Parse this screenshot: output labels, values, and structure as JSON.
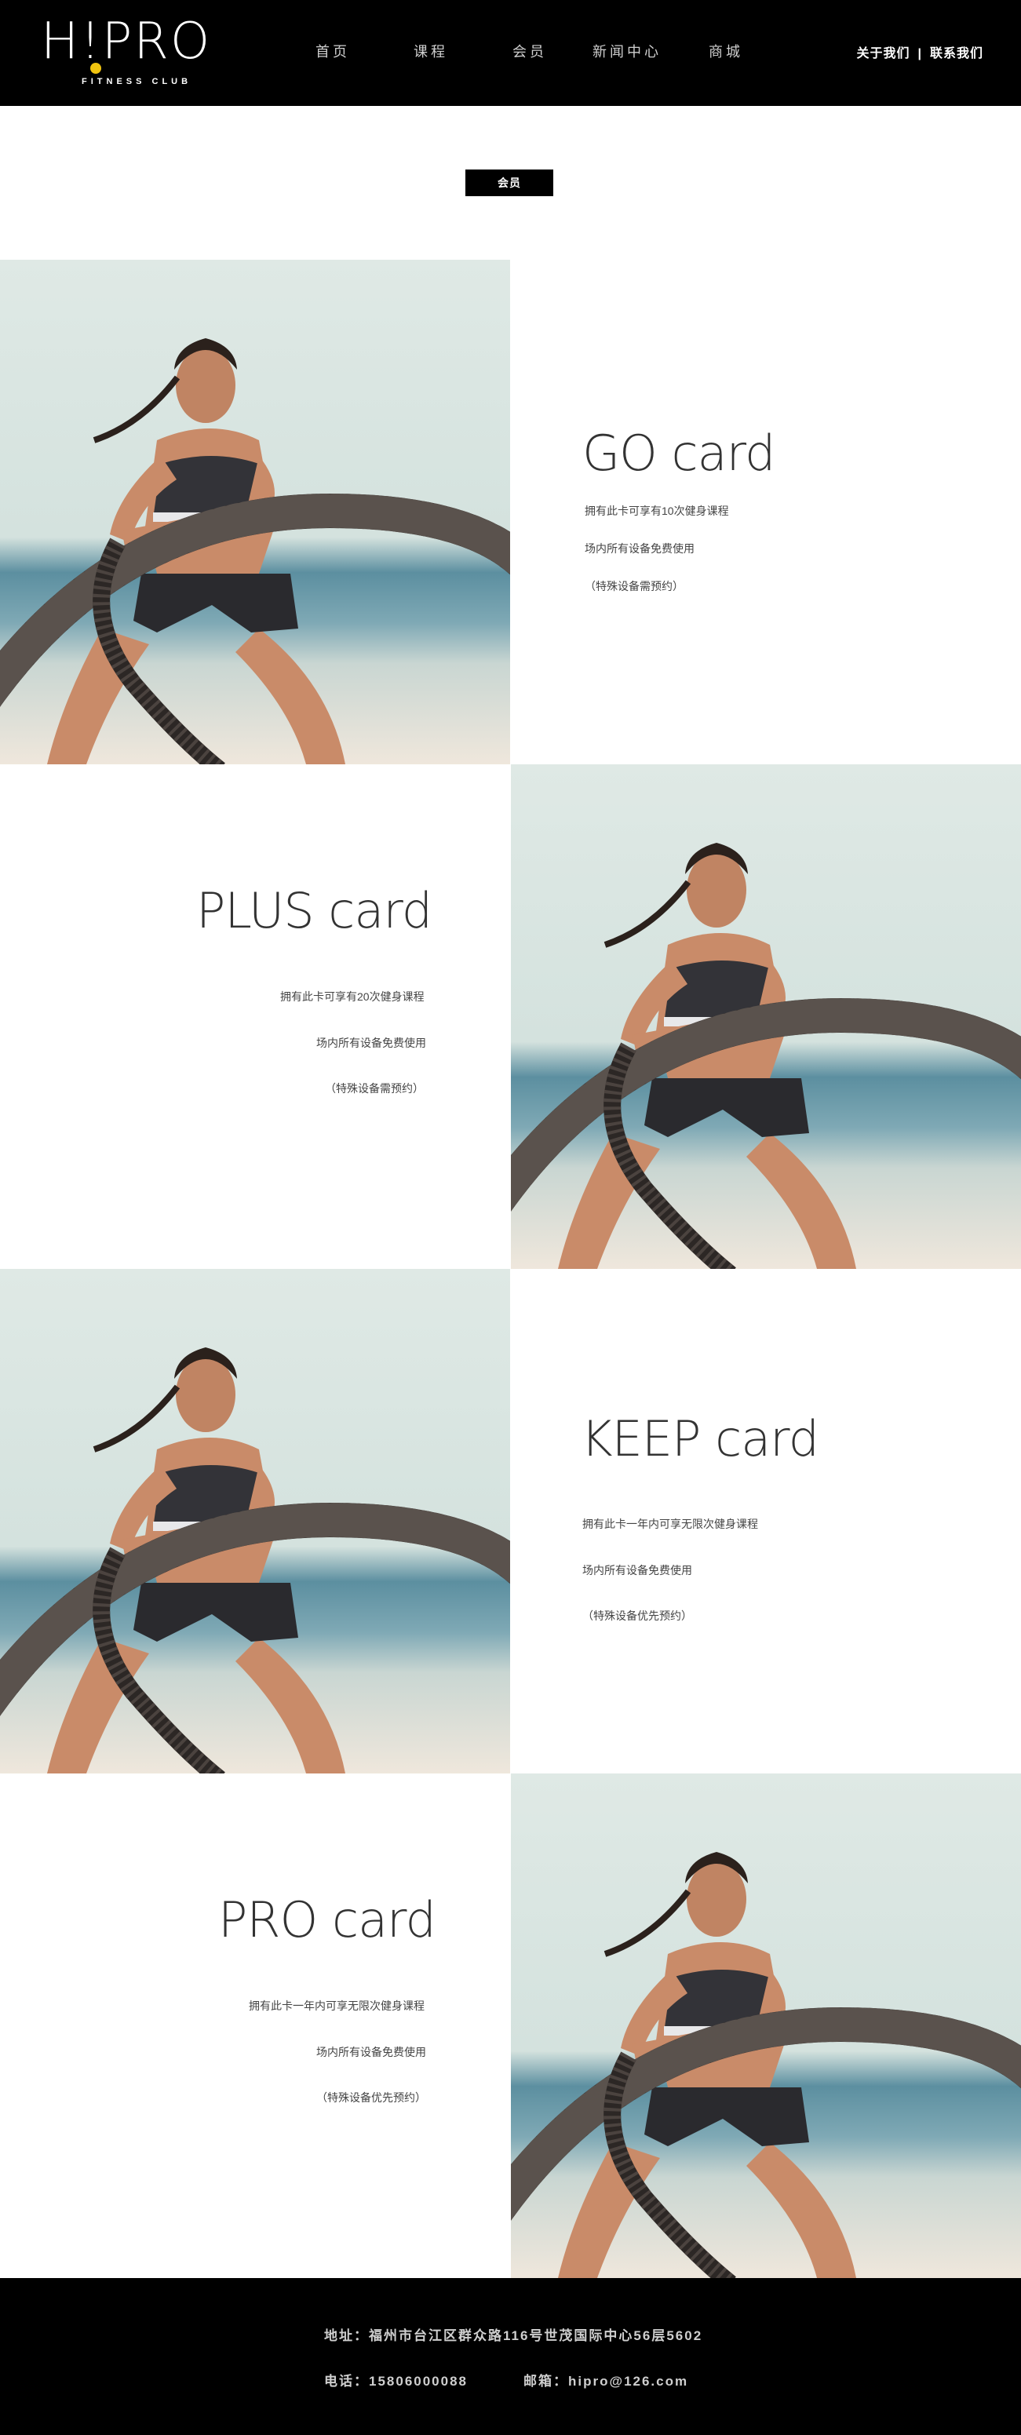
{
  "header": {
    "logo_main": "H!PRO",
    "logo_sub": "FITNESS CLUB",
    "nav": [
      "首页",
      "课程",
      "会员",
      "新闻中心",
      "商城"
    ],
    "about_label": "关于我们",
    "separator": "|",
    "contact_label": "联系我们"
  },
  "section": {
    "tag": "会员"
  },
  "cards": [
    {
      "title": "GO card",
      "lines": [
        "拥有此卡可享有10次健身课程",
        "场内所有设备免费使用",
        "（特殊设备需预约）"
      ]
    },
    {
      "title": "PLUS card",
      "lines": [
        "拥有此卡可享有20次健身课程",
        "场内所有设备免费使用",
        "（特殊设备需预约）"
      ]
    },
    {
      "title": "KEEP card",
      "lines": [
        "拥有此卡一年内可享无限次健身课程",
        "场内所有设备免费使用",
        "（特殊设备优先预约）"
      ]
    },
    {
      "title": "PRO card",
      "lines": [
        "拥有此卡一年内可享无限次健身课程",
        "场内所有设备免费使用",
        "（特殊设备优先预约）"
      ]
    }
  ],
  "footer": {
    "address": "地址：福州市台江区群众路116号世茂国际中心56层5602",
    "phone": "电话：15806000088",
    "email": "邮箱：hipro@126.com"
  },
  "colors": {
    "header_bg": "#000000",
    "logo_dot": "#f1c40f",
    "tag_bg": "#000000",
    "footer_bg": "#000000"
  }
}
